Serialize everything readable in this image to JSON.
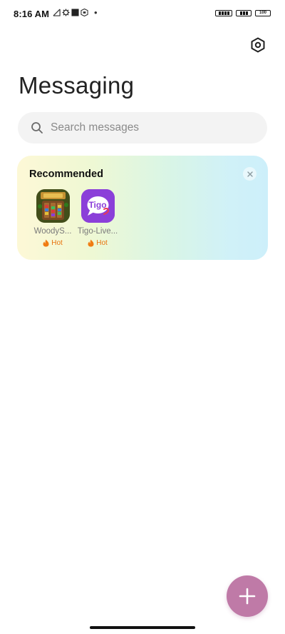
{
  "status_bar": {
    "time": "8:16 AM",
    "dot": "•",
    "battery": "100"
  },
  "header": {
    "title": "Messaging"
  },
  "search": {
    "placeholder": "Search messages",
    "value": ""
  },
  "recommended": {
    "title": "Recommended",
    "apps": [
      {
        "name": "WoodyS...",
        "badge": "Hot",
        "icon": "woody-game-icon"
      },
      {
        "name": "Tigo-Live...",
        "badge": "Hot",
        "icon": "tigo-icon",
        "icon_text": "Tigo"
      }
    ]
  },
  "colors": {
    "fab": "#bf7aa7",
    "hot": "#e8730e",
    "tigo": "#8b3fd9"
  },
  "icons": {
    "settings": "settings-hexagon-icon",
    "search": "search-icon",
    "close": "close-icon",
    "fab": "plus-icon",
    "hot": "flame-icon"
  }
}
